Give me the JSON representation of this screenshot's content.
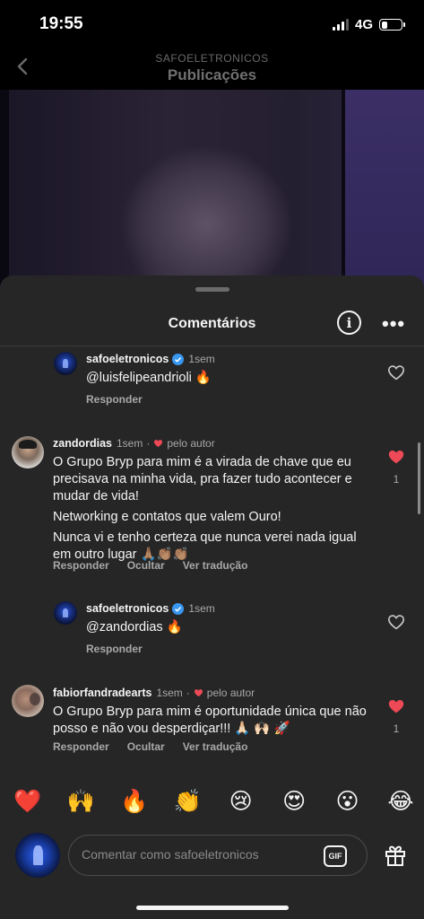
{
  "status_bar": {
    "time": "19:55",
    "network": "4G",
    "battery_level": 0.3
  },
  "header": {
    "account": "SAFOELETRONICOS",
    "title": "Publicações"
  },
  "sheet": {
    "title": "Comentários"
  },
  "comments": [
    {
      "username": "safoeletronicos",
      "verified": true,
      "time": "1sem",
      "text": [
        "@luisfelipeandrioli 🔥"
      ],
      "actions": [
        "Responder"
      ],
      "liked": false,
      "likes": ""
    },
    {
      "username": "zandordias",
      "verified": false,
      "time": "1sem",
      "author_like": "pelo autor",
      "text": [
        "O Grupo Bryp para mim é a virada de chave que eu precisava na minha vida, pra fazer tudo acontecer e mudar de vida!",
        "Networking e contatos que valem Ouro!",
        "Nunca vi e tenho certeza que nunca verei nada igual em outro lugar 🙏🏽👏🏽👏🏽"
      ],
      "actions": [
        "Responder",
        "Ocultar",
        "Ver tradução"
      ],
      "liked": true,
      "likes": "1"
    },
    {
      "username": "safoeletronicos",
      "verified": true,
      "time": "1sem",
      "text": [
        "@zandordias 🔥"
      ],
      "actions": [
        "Responder"
      ],
      "liked": false,
      "likes": ""
    },
    {
      "username": "fabiorfandradearts",
      "verified": false,
      "time": "1sem",
      "author_like": "pelo autor",
      "text": [
        "O Grupo Bryp para mim é oportunidade única que não posso e não vou desperdiçar!!! 🙏🏻 🙌🏻 🚀"
      ],
      "actions": [
        "Responder",
        "Ocultar",
        "Ver tradução"
      ],
      "liked": true,
      "likes": "1"
    }
  ],
  "emoji_bar": [
    "❤️",
    "🙌",
    "🔥",
    "👏",
    "😢",
    "😍",
    "😮",
    "😂"
  ],
  "composer": {
    "placeholder": "Comentar como safoeletronicos",
    "gif_label": "GIF"
  },
  "colors": {
    "accent_red": "#ed4956",
    "verified_blue": "#3897f0",
    "sheet_bg": "#262626"
  },
  "icons": [
    "back-icon",
    "info-icon",
    "more-icon",
    "heart-icon",
    "verified-icon",
    "gif-icon",
    "gift-icon"
  ]
}
